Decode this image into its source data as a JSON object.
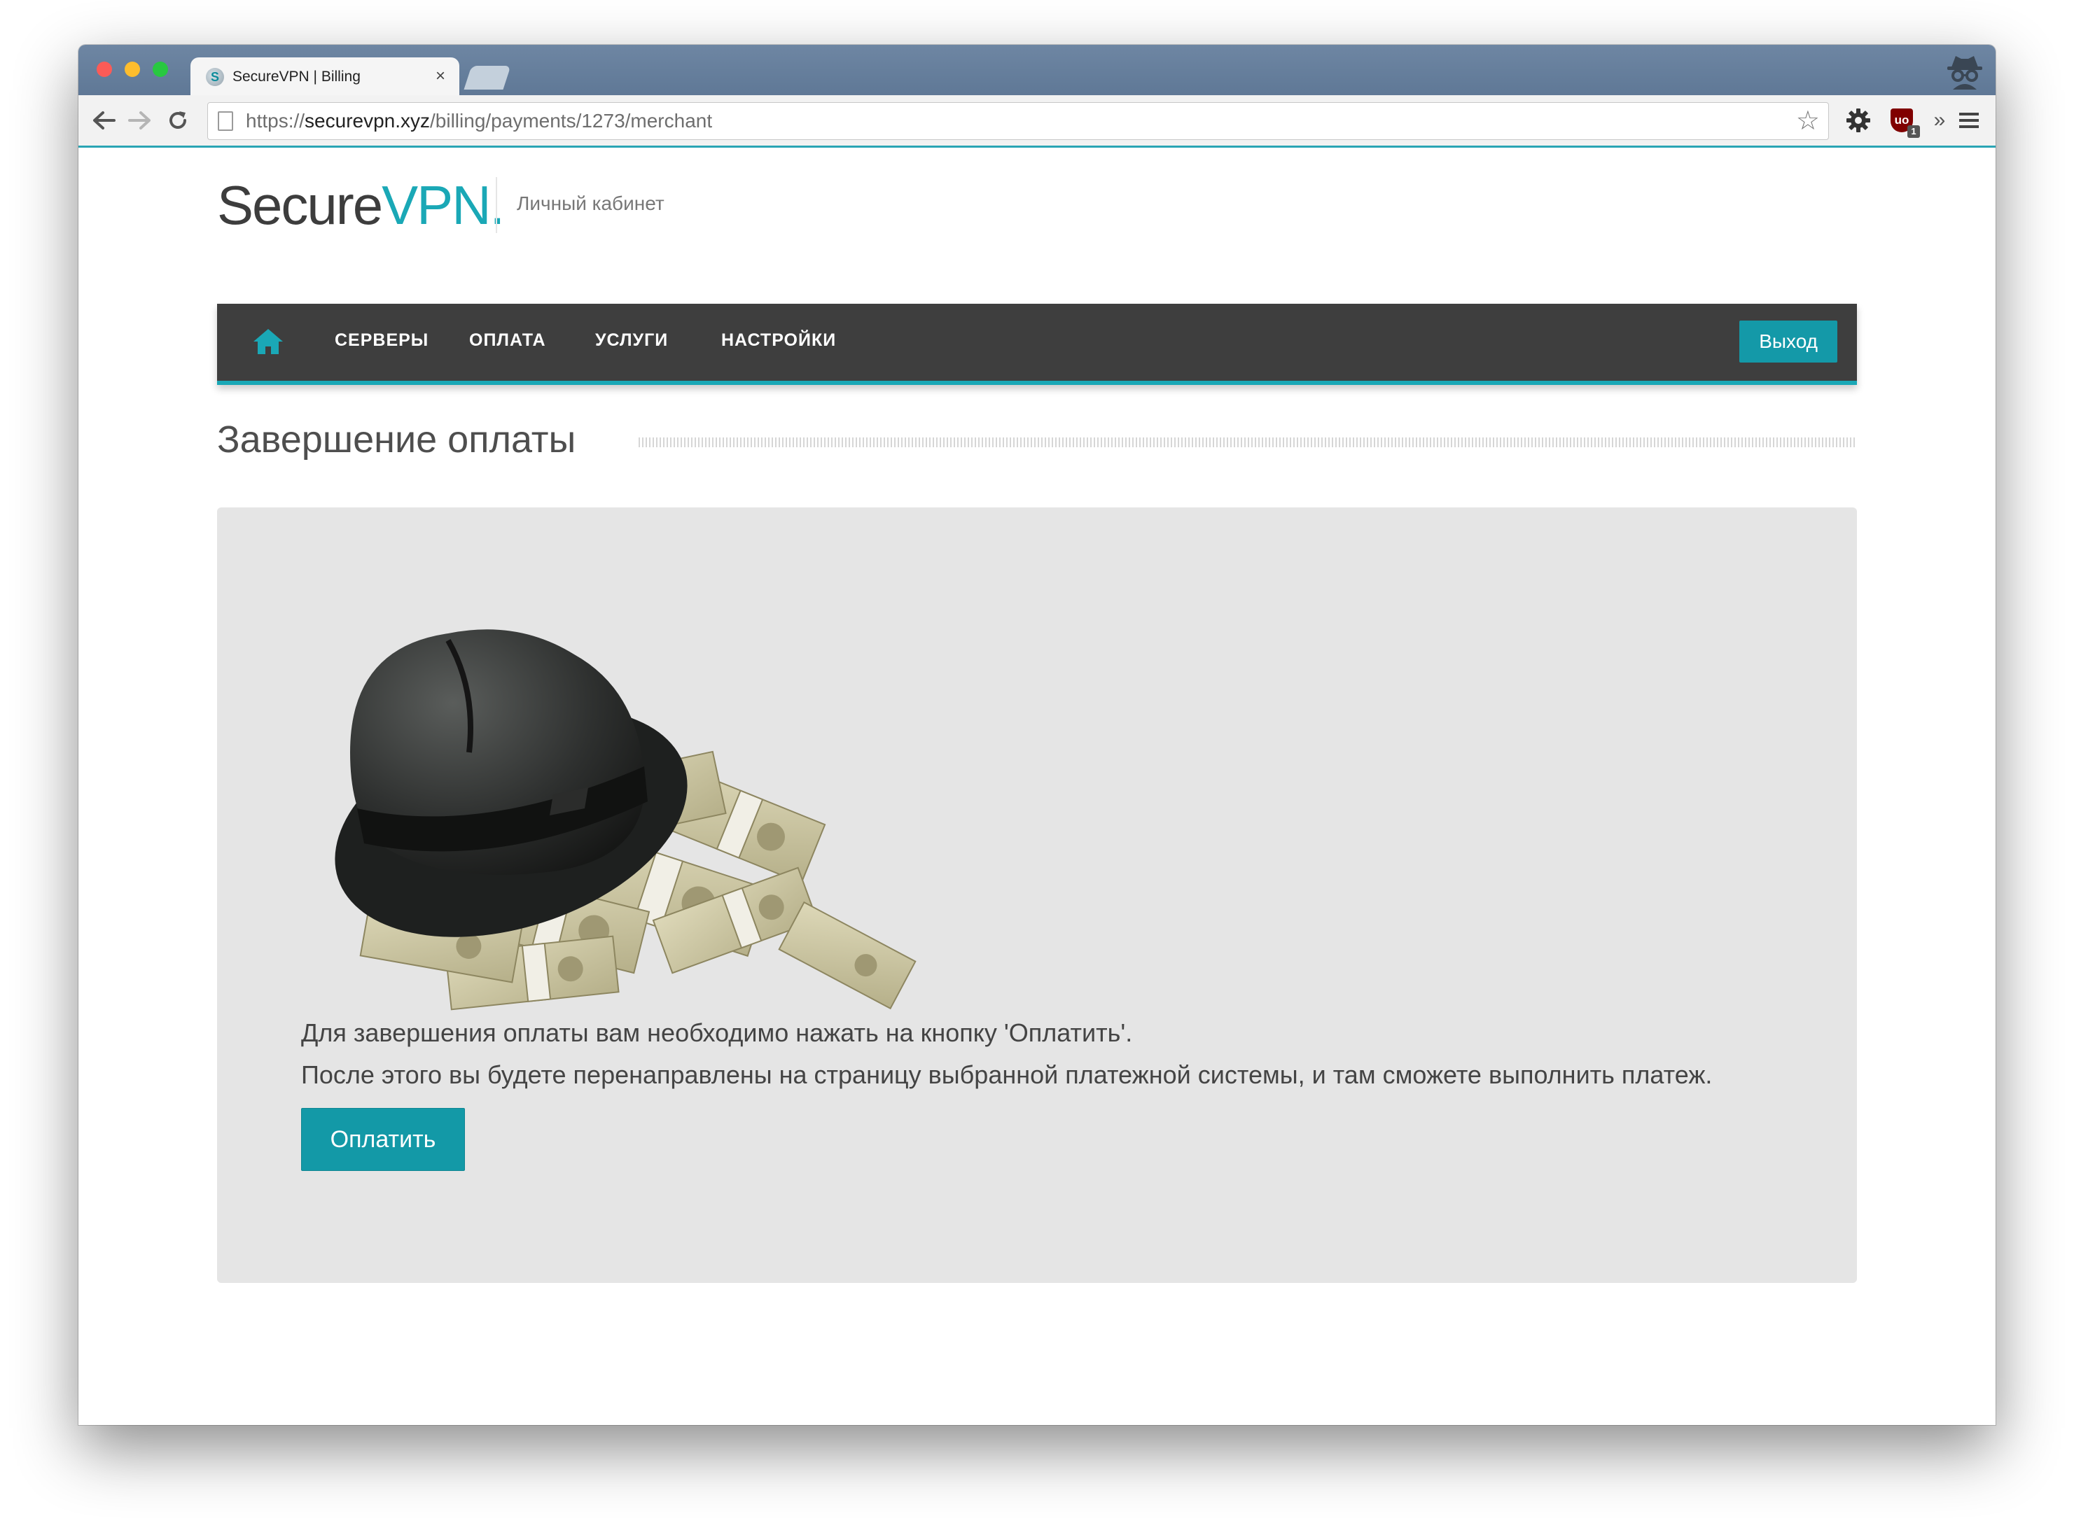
{
  "browser": {
    "tab": {
      "title": "SecureVPN | Billing",
      "close": "×"
    },
    "url": {
      "scheme": "https://",
      "host": "securevpn.xyz",
      "path": "/billing/payments/1273/merchant"
    },
    "extension_badge": "1"
  },
  "site": {
    "logo": {
      "part1": "Secure",
      "part2": "VPN."
    },
    "subtitle": "Личный кабинет"
  },
  "navbar": {
    "items": [
      {
        "label": "СЕРВЕРЫ"
      },
      {
        "label": "ОПЛАТА"
      },
      {
        "label": "УСЛУГИ"
      },
      {
        "label": "НАСТРОЙКИ"
      }
    ],
    "logout_label": "Выход"
  },
  "main": {
    "title": "Завершение оплаты",
    "message_line1": "Для завершения оплаты вам необходимо нажать на кнопку 'Оплатить'.",
    "message_line2": "После этого вы будете перенаправлены на страницу выбранной платежной системы, и там сможете выполнить платеж.",
    "pay_label": "Оплатить"
  },
  "colors": {
    "accent": "#1aa8b6",
    "navbar_bg": "#3e3e3e",
    "panel_bg": "#e5e5e5",
    "tabstrip": "#6e86a3"
  },
  "icons": {
    "back": "arrow-left-icon",
    "forward": "arrow-right-icon",
    "reload": "reload-icon",
    "bookmark": "star-icon",
    "settings": "gear-icon",
    "menu": "hamburger-icon",
    "home": "home-icon"
  }
}
